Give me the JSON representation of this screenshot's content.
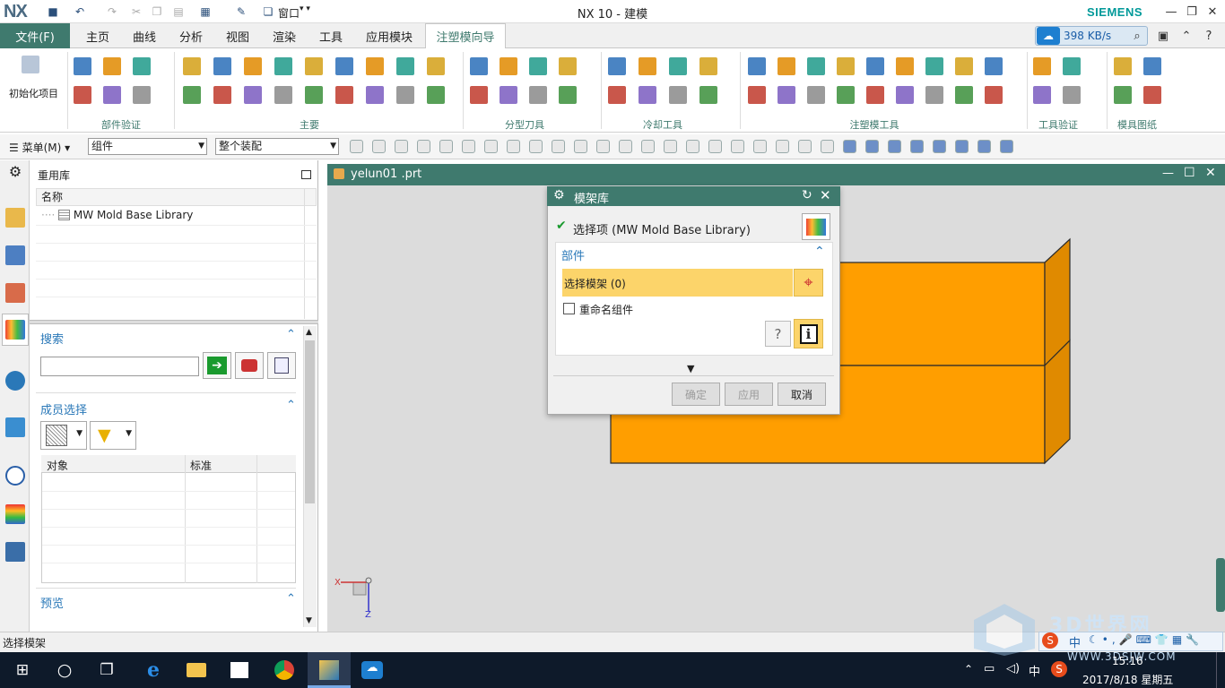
{
  "app": {
    "logo": "NX",
    "window_title": "NX 10 - 建模",
    "brand": "SIEMENS",
    "window_menu_label": "窗口",
    "net_speed": "398 KB/s"
  },
  "menu": {
    "file": "文件(F)",
    "tabs": [
      "主页",
      "曲线",
      "分析",
      "视图",
      "渲染",
      "工具",
      "应用模块",
      "注塑模向导"
    ],
    "active_tab": "注塑模向导"
  },
  "ribbon": {
    "init_label": "初始化项目",
    "groups": [
      "部件验证",
      "主要",
      "分型刀具",
      "冷却工具",
      "注塑模工具",
      "工具验证",
      "模具图纸"
    ]
  },
  "command_bar": {
    "menu_label": "菜单(M)",
    "filter_value": "组件",
    "scope_value": "整个装配"
  },
  "navigator": {
    "title": "重用库",
    "column_name": "名称",
    "tree_item": "MW Mold Base Library",
    "search_title": "搜索",
    "member_title": "成员选择",
    "grid_headers": [
      "对象",
      "标准"
    ],
    "preview_title": "预览"
  },
  "viewport": {
    "file_tab": "yelun01 .prt",
    "axis_x": "X",
    "axis_z": "Z"
  },
  "dialog": {
    "title": "模架库",
    "selected_text": "选择项 (MW Mold Base Library)",
    "section_title": "部件",
    "select_frame": "选择模架 (0)",
    "rename_label": "重命名组件",
    "ok": "确定",
    "apply": "应用",
    "cancel": "取消"
  },
  "status": {
    "message": "选择模架"
  },
  "taskbar": {
    "time": "15:16",
    "date": "2017/8/18 星期五",
    "ime": "中",
    "watermark": "3D世界网",
    "watermark_url": "WWW.3DSJW.COM"
  },
  "colors": {
    "accent": "#3f7a6e",
    "selection": "#fcd46a",
    "model": "#ff9e00",
    "link": "#2a78b8"
  }
}
